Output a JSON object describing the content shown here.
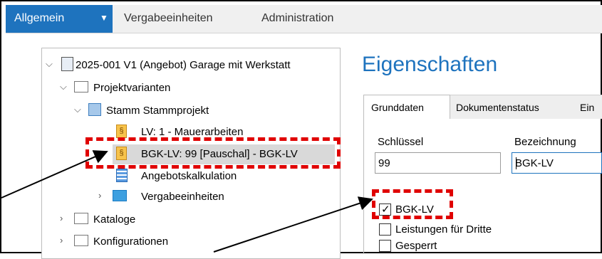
{
  "menu": {
    "active_label": "Allgemein",
    "items": [
      "Vergabeeinheiten",
      "Administration"
    ]
  },
  "tree": {
    "root": "2025-001 V1 (Angebot) Garage mit Werkstatt",
    "projektvarianten": "Projektvarianten",
    "stamm": "Stamm Stammprojekt",
    "lv_item": "LV: 1 - Mauerarbeiten",
    "bgk_item": "BGK-LV: 99 [Pauschal] - BGK-LV",
    "kalkulation": "Angebotskalkulation",
    "vergabeeinheiten": "Vergabeeinheiten",
    "kataloge": "Kataloge",
    "konfigurationen": "Konfigurationen"
  },
  "properties": {
    "title": "Eigenschaften",
    "tabs": [
      "Grunddaten",
      "Dokumentenstatus",
      "Ein"
    ],
    "schluessel_label": "Schlüssel",
    "schluessel_value": "99",
    "bezeichnung_label": "Bezeichnung",
    "bezeichnung_value": "BGK-LV",
    "checkboxes": [
      {
        "label": "BGK-LV",
        "checked": true
      },
      {
        "label": "Leistungen für Dritte",
        "checked": false
      },
      {
        "label": "Gesperrt",
        "checked": false
      }
    ]
  },
  "colors": {
    "accent": "#1e73be",
    "highlight": "#e00000",
    "selection": "#d9d9d9"
  }
}
